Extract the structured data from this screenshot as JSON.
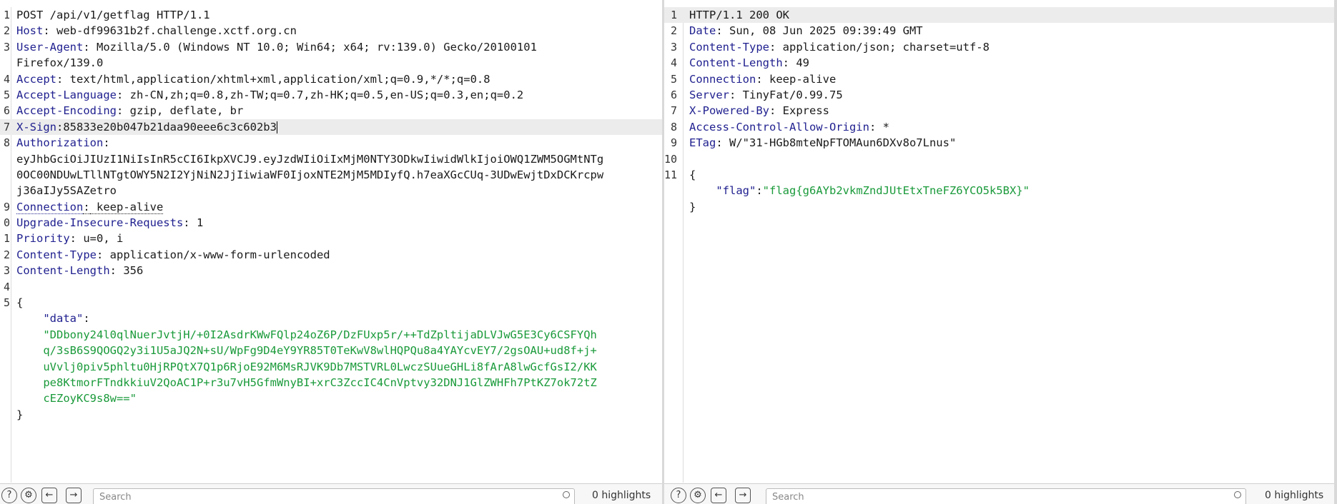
{
  "request": {
    "lines": [
      {
        "n": "1",
        "text": "POST /api/v1/getflag HTTP/1.1"
      },
      {
        "n": "2",
        "name": "Host",
        "value": " web-df99631b2f.challenge.xctf.org.cn"
      },
      {
        "n": "3",
        "name": "User-Agent",
        "value": " Mozilla/5.0 (Windows NT 10.0; Win64; x64; rv:139.0) Gecko/20100101"
      },
      {
        "n": "",
        "text": "Firefox/139.0"
      },
      {
        "n": "4",
        "name": "Accept",
        "value": " text/html,application/xhtml+xml,application/xml;q=0.9,*/*;q=0.8"
      },
      {
        "n": "5",
        "name": "Accept-Language",
        "value": " zh-CN,zh;q=0.8,zh-TW;q=0.7,zh-HK;q=0.5,en-US;q=0.3,en;q=0.2"
      },
      {
        "n": "6",
        "name": "Accept-Encoding",
        "value": " gzip, deflate, br"
      },
      {
        "n": "7",
        "name": "X-Sign",
        "value": "85833e20b047b21daa90eee6c3c602b3"
      },
      {
        "n": "8",
        "name": "Authorization",
        "value": ""
      },
      {
        "n": "",
        "text": "eyJhbGciOiJIUzI1NiIsInR5cCI6IkpXVCJ9.eyJzdWIiOiIxMjM0NTY3ODkwIiwidWlkIjoiOWQ1ZWM5OGMtNTg"
      },
      {
        "n": "",
        "text": "0OC00NDUwLTllNTgtOWY5N2I2YjNiN2JjIiwiaWF0IjoxNTE2MjM5MDIyfQ.h7eaXGcCUq-3UDwEwjtDxDCKrcpw"
      },
      {
        "n": "",
        "text": "j36aIJy5SAZetro"
      },
      {
        "n": "9",
        "name": "Connection",
        "value": " keep-alive"
      },
      {
        "n": "0",
        "name": "Upgrade-Insecure-Requests",
        "value": " 1"
      },
      {
        "n": "1",
        "name": "Priority",
        "value": " u=0, i"
      },
      {
        "n": "2",
        "name": "Content-Type",
        "value": " application/x-www-form-urlencoded"
      },
      {
        "n": "3",
        "name": "Content-Length",
        "value": " 356"
      },
      {
        "n": "4",
        "text": ""
      },
      {
        "n": "5",
        "text": "{"
      },
      {
        "n": "",
        "key": "\"data\"",
        "text": ":"
      },
      {
        "n": "",
        "str": "\"DDbony24l0qlNuerJvtjH/+0I2AsdrKWwFQlp24oZ6P/DzFUxp5r/++TdZpltijaDLVJwG5E3Cy6CSFYQh"
      },
      {
        "n": "",
        "str": "q/3sB6S9QOGQ2y3i1U5aJQ2N+sU/WpFg9D4eY9YR85T0TeKwV8wlHQPQu8a4YAYcvEY7/2gsOAU+ud8f+j+"
      },
      {
        "n": "",
        "str": "uVvlj0piv5phltu0HjRPQtX7Q1p6RjoE92M6MsRJVK9Db7MSTVRL0LwczSUueGHLi8fArA8lwGcfGsI2/KK"
      },
      {
        "n": "",
        "str": "pe8KtmorFTndkkiuV2QoAC1P+r3u7vH5GfmWnyBI+xrC3ZccIC4CnVptvy32DNJ1GlZWHFh7PtKZ7ok72tZ"
      },
      {
        "n": "",
        "str": "cEZoyKC9s8w==\""
      },
      {
        "n": "",
        "text": "}"
      }
    ]
  },
  "response": {
    "lines": [
      {
        "n": "1",
        "text": "HTTP/1.1 200 OK"
      },
      {
        "n": "2",
        "name": "Date",
        "value": " Sun, 08 Jun 2025 09:39:49 GMT"
      },
      {
        "n": "3",
        "name": "Content-Type",
        "value": " application/json; charset=utf-8"
      },
      {
        "n": "4",
        "name": "Content-Length",
        "value": " 49"
      },
      {
        "n": "5",
        "name": "Connection",
        "value": " keep-alive"
      },
      {
        "n": "6",
        "name": "Server",
        "value": " TinyFat/0.99.75"
      },
      {
        "n": "7",
        "name": "X-Powered-By",
        "value": " Express"
      },
      {
        "n": "8",
        "name": "Access-Control-Allow-Origin",
        "value": " *"
      },
      {
        "n": "9",
        "name": "ETag",
        "value": " W/\"31-HGb8mteNpFTOMAun6DXv8o7Lnus\""
      },
      {
        "n": "10",
        "text": ""
      },
      {
        "n": "11",
        "text": "{"
      },
      {
        "n": "",
        "key": "\"flag\"",
        "text": ":",
        "str": "\"flag{g6AYb2vkmZndJUtEtxTneFZ6YCO5k5BX}\""
      },
      {
        "n": "",
        "text": "}"
      }
    ]
  },
  "statusbar": {
    "help_icon": "?",
    "settings_icon": "gear-icon",
    "back_icon": "arrow-left-icon",
    "forward_icon": "arrow-right-icon",
    "search_placeholder": "Search",
    "highlights_label": "0 highlights"
  }
}
